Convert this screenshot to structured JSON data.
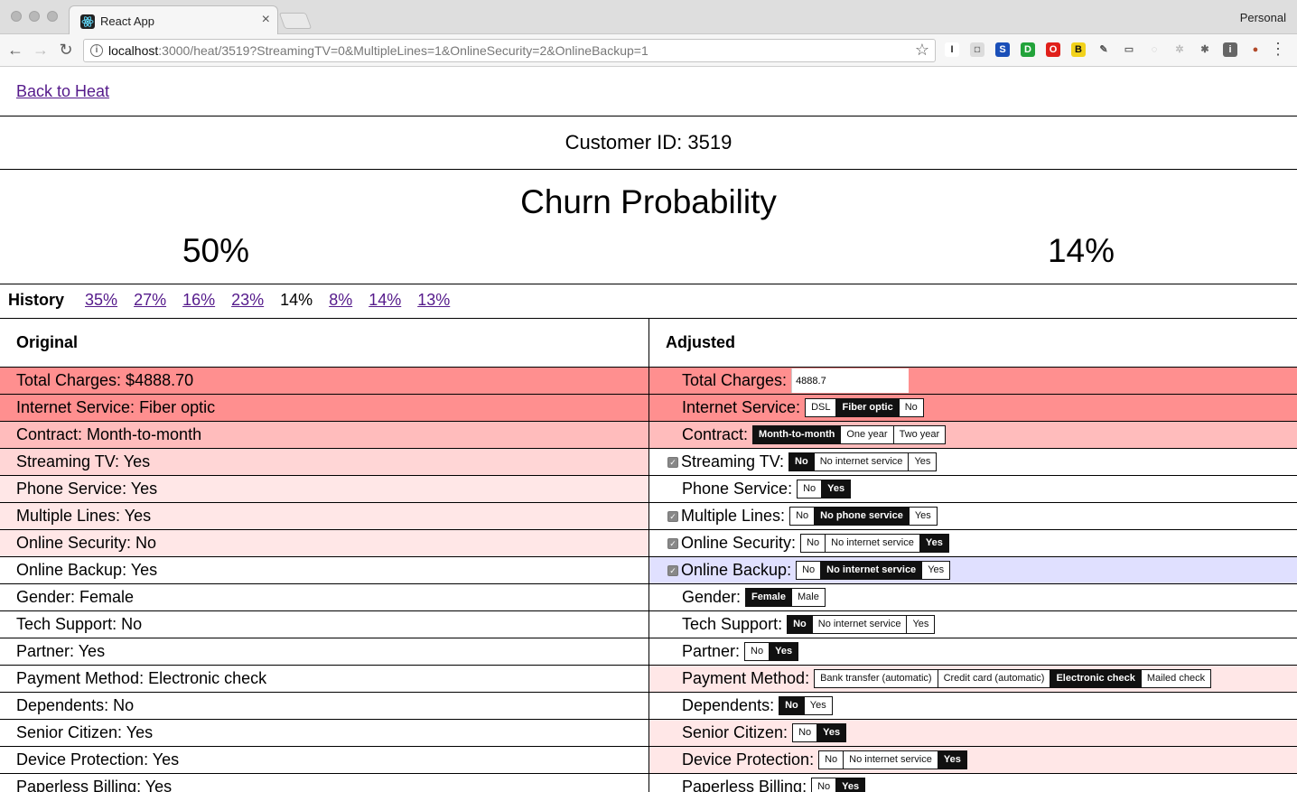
{
  "browser": {
    "tab_title": "React App",
    "tab_close": "×",
    "profile": "Personal",
    "url_host": "localhost",
    "url_path": ":3000/heat/3519?StreamingTV=0&MultipleLines=1&OnlineSecurity=2&OnlineBackup=1",
    "back_glyph": "←",
    "forward_glyph": "→",
    "reload_glyph": "↻",
    "star_glyph": "☆",
    "menu_glyph": "⋮",
    "extensions": [
      {
        "name": "i-extension-icon",
        "glyph": "I",
        "color": "#ffffff",
        "text": "#222222"
      },
      {
        "name": "camera-extension-icon",
        "glyph": "◘",
        "color": "#dcdcdc",
        "text": "#888888"
      },
      {
        "name": "s-extension-icon",
        "glyph": "S",
        "color": "#1a4fb8",
        "text": "#ffffff"
      },
      {
        "name": "green-extension-icon",
        "glyph": "D",
        "color": "#22a33a",
        "text": "#ffffff"
      },
      {
        "name": "opera-extension-icon",
        "glyph": "O",
        "color": "#e0201a",
        "text": "#ffffff"
      },
      {
        "name": "b-extension-icon",
        "glyph": "B",
        "color": "#f2d21b",
        "text": "#111111"
      },
      {
        "name": "pin-extension-icon",
        "glyph": "✎",
        "color": "#f6f6f6",
        "text": "#555555"
      },
      {
        "name": "cast-extension-icon",
        "glyph": "▭",
        "color": "#f6f6f6",
        "text": "#666666"
      },
      {
        "name": "circle-extension-icon",
        "glyph": "◌",
        "color": "#f6f6f6",
        "text": "#bbbbbb"
      },
      {
        "name": "gear-extension-icon",
        "glyph": "✲",
        "color": "#f6f6f6",
        "text": "#bbbbbb"
      },
      {
        "name": "bug-extension-icon",
        "glyph": "✱",
        "color": "#f6f6f6",
        "text": "#666666"
      },
      {
        "name": "info-extension-icon",
        "glyph": "i",
        "color": "#666666",
        "text": "#ffffff"
      },
      {
        "name": "bee-extension-icon",
        "glyph": "●",
        "color": "#f6f6f6",
        "text": "#b24a2a"
      }
    ]
  },
  "page": {
    "back_link": "Back to Heat",
    "customer_id": "Customer ID: 3519",
    "churn_title": "Churn Probability",
    "original_probability": "50%",
    "adjusted_probability": "14%",
    "history_label": "History",
    "history": [
      {
        "label": "35%",
        "current": false
      },
      {
        "label": "27%",
        "current": false
      },
      {
        "label": "16%",
        "current": false
      },
      {
        "label": "23%",
        "current": false
      },
      {
        "label": "14%",
        "current": true
      },
      {
        "label": "8%",
        "current": false
      },
      {
        "label": "14%",
        "current": false
      },
      {
        "label": "13%",
        "current": false
      }
    ],
    "col_original": "Original",
    "col_adjusted": "Adjusted"
  },
  "rows": [
    {
      "original": "Total Charges: $4888.70",
      "label": "Total Charges:",
      "input": "4888.7",
      "checked": false,
      "left_bg": "bg-strong",
      "right_bg": "bg-strong",
      "options": [],
      "selected": -1
    },
    {
      "original": "Internet Service: Fiber optic",
      "label": "Internet Service:",
      "checked": false,
      "left_bg": "bg-strong",
      "right_bg": "bg-strong",
      "options": [
        "DSL",
        "Fiber optic",
        "No"
      ],
      "selected": 1
    },
    {
      "original": "Contract: Month-to-month",
      "label": "Contract:",
      "checked": false,
      "left_bg": "bg-med",
      "right_bg": "bg-med",
      "options": [
        "Month-to-month",
        "One year",
        "Two year"
      ],
      "selected": 0
    },
    {
      "original": "Streaming TV: Yes",
      "label": "Streaming TV:",
      "checked": true,
      "left_bg": "bg-light",
      "right_bg": "bg-none",
      "options": [
        "No",
        "No internet service",
        "Yes"
      ],
      "selected": 0
    },
    {
      "original": "Phone Service: Yes",
      "label": "Phone Service:",
      "checked": false,
      "left_bg": "bg-pale",
      "right_bg": "bg-none",
      "options": [
        "No",
        "Yes"
      ],
      "selected": 1
    },
    {
      "original": "Multiple Lines: Yes",
      "label": "Multiple Lines:",
      "checked": true,
      "left_bg": "bg-pale",
      "right_bg": "bg-none",
      "options": [
        "No",
        "No phone service",
        "Yes"
      ],
      "selected": 1
    },
    {
      "original": "Online Security: No",
      "label": "Online Security:",
      "checked": true,
      "left_bg": "bg-pale",
      "right_bg": "bg-none",
      "options": [
        "No",
        "No internet service",
        "Yes"
      ],
      "selected": 2
    },
    {
      "original": "Online Backup: Yes",
      "label": "Online Backup:",
      "checked": true,
      "left_bg": "bg-none",
      "right_bg": "bg-blue",
      "options": [
        "No",
        "No internet service",
        "Yes"
      ],
      "selected": 1
    },
    {
      "original": "Gender: Female",
      "label": "Gender:",
      "checked": false,
      "left_bg": "bg-none",
      "right_bg": "bg-none",
      "options": [
        "Female",
        "Male"
      ],
      "selected": 0
    },
    {
      "original": "Tech Support: No",
      "label": "Tech Support:",
      "checked": false,
      "left_bg": "bg-none",
      "right_bg": "bg-none",
      "options": [
        "No",
        "No internet service",
        "Yes"
      ],
      "selected": 0
    },
    {
      "original": "Partner: Yes",
      "label": "Partner:",
      "checked": false,
      "left_bg": "bg-none",
      "right_bg": "bg-none",
      "options": [
        "No",
        "Yes"
      ],
      "selected": 1
    },
    {
      "original": "Payment Method: Electronic check",
      "label": "Payment Method:",
      "checked": false,
      "left_bg": "bg-none",
      "right_bg": "bg-pale",
      "options": [
        "Bank transfer (automatic)",
        "Credit card (automatic)",
        "Electronic check",
        "Mailed check"
      ],
      "selected": 2
    },
    {
      "original": "Dependents: No",
      "label": "Dependents:",
      "checked": false,
      "left_bg": "bg-none",
      "right_bg": "bg-none",
      "options": [
        "No",
        "Yes"
      ],
      "selected": 0
    },
    {
      "original": "Senior Citizen: Yes",
      "label": "Senior Citizen:",
      "checked": false,
      "left_bg": "bg-none",
      "right_bg": "bg-pale",
      "options": [
        "No",
        "Yes"
      ],
      "selected": 1
    },
    {
      "original": "Device Protection: Yes",
      "label": "Device Protection:",
      "checked": false,
      "left_bg": "bg-none",
      "right_bg": "bg-pale",
      "options": [
        "No",
        "No internet service",
        "Yes"
      ],
      "selected": 2
    },
    {
      "original": "Paperless Billing: Yes",
      "label": "Paperless Billing:",
      "checked": false,
      "left_bg": "bg-none",
      "right_bg": "bg-none",
      "options": [
        "No",
        "Yes"
      ],
      "selected": 1
    }
  ]
}
